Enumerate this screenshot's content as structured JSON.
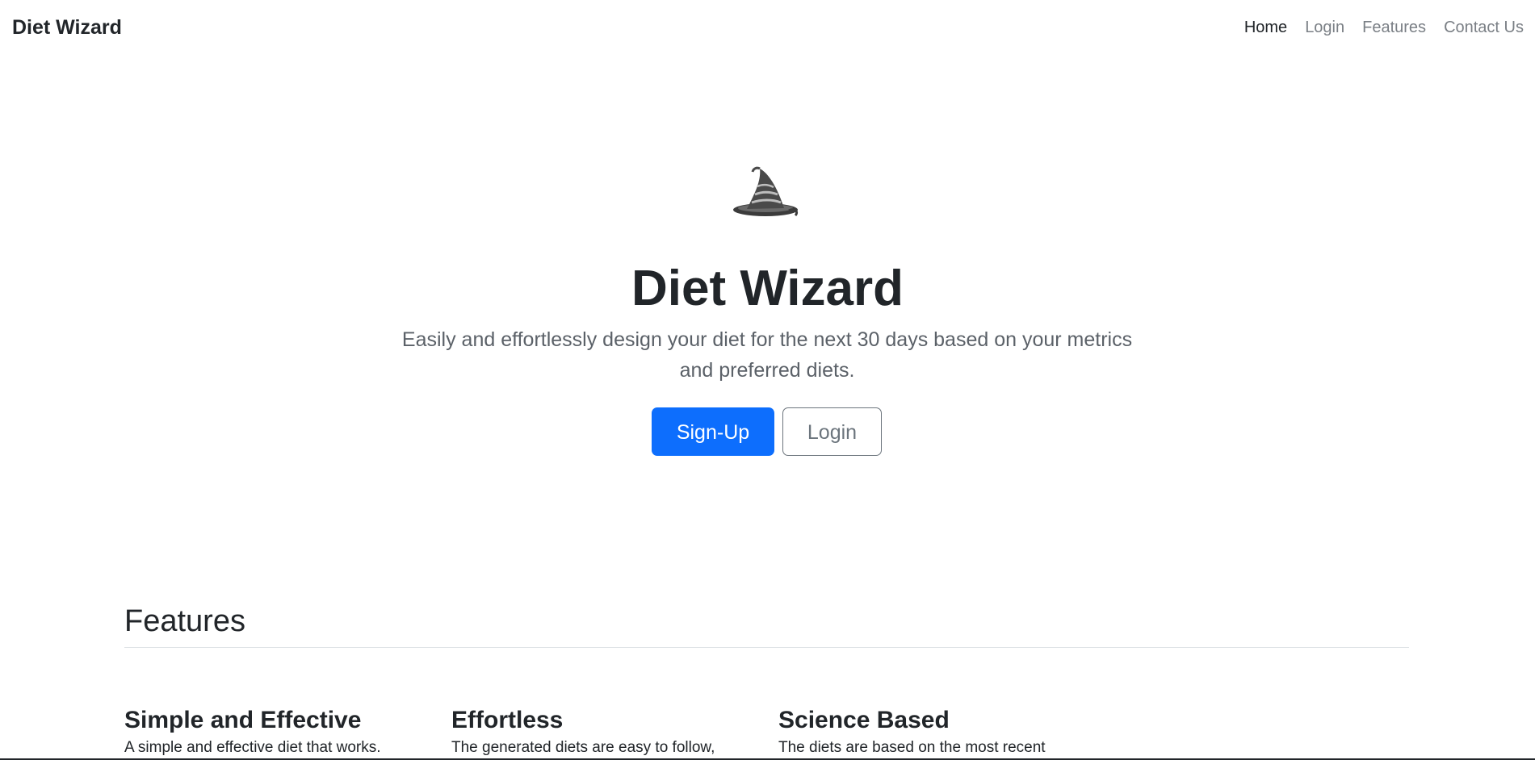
{
  "navbar": {
    "brand": "Diet Wizard",
    "links": [
      {
        "label": "Home",
        "active": true
      },
      {
        "label": "Login",
        "active": false
      },
      {
        "label": "Features",
        "active": false
      },
      {
        "label": "Contact Us",
        "active": false
      }
    ]
  },
  "hero": {
    "icon": "wizard-hat-icon",
    "title": "Diet Wizard",
    "lead": "Easily and effortlessly design your diet for the next 30 days based on your metrics and preferred diets.",
    "primary_button": "Sign-Up",
    "secondary_button": "Login"
  },
  "features": {
    "title": "Features",
    "items": [
      {
        "title": "Simple and Effective",
        "text": "A simple and effective diet that works."
      },
      {
        "title": "Effortless",
        "text": "The generated diets are easy to follow,"
      },
      {
        "title": "Science Based",
        "text": "The diets are based on the most recent"
      }
    ]
  },
  "colors": {
    "primary": "#0d6efd",
    "text": "#212529",
    "muted": "#6c757d"
  }
}
